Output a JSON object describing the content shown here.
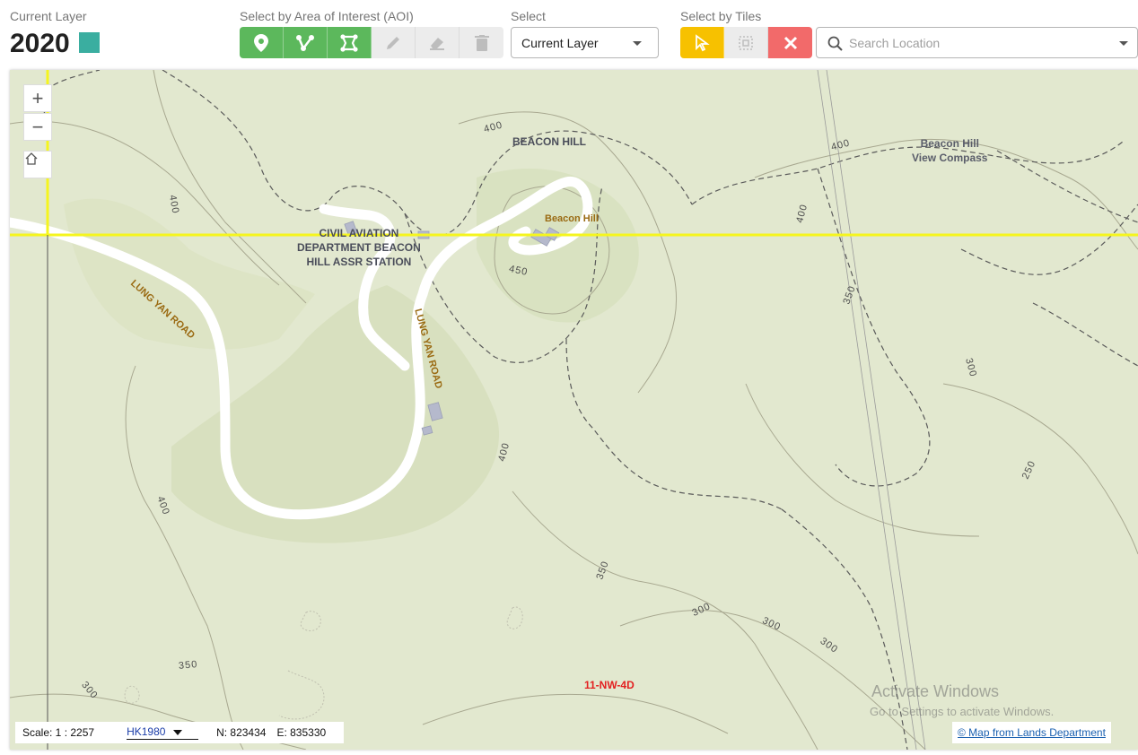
{
  "header": {
    "current_layer_label": "Current Layer",
    "year": "2020",
    "swatch_color": "#3aaea0",
    "aoi_label": "Select by Area of Interest (AOI)",
    "select_label": "Select",
    "select_value": "Current Layer",
    "tiles_label": "Select by Tiles",
    "search_placeholder": "Search Location"
  },
  "aoi_tools": [
    "point-icon",
    "polyline-icon",
    "polygon-icon",
    "pencil-icon",
    "eraser-icon",
    "trash-icon"
  ],
  "tile_tools": [
    "cursor-select-icon",
    "box-select-icon",
    "close-icon"
  ],
  "map": {
    "places": {
      "beacon_hill": "BEACON HILL",
      "beacon_hill_view_1": "Beacon Hill",
      "beacon_hill_view_2": "View Compass",
      "cad_1": "CIVIL AVIATION",
      "cad_2": "DEPARTMENT BEACON",
      "cad_3": "HILL ASSR STATION",
      "beacon_hill_peak": "Beacon Hill"
    },
    "roads": [
      "LUNG YAN ROAD",
      "LUNG YAN ROAD"
    ],
    "contours": [
      "400",
      "400",
      "400",
      "400",
      "450",
      "400",
      "350",
      "300",
      "250",
      "400",
      "350",
      "300",
      "300",
      "300",
      "350",
      "300"
    ],
    "tile_code": "11-NW-4D",
    "grid_line_color": "#f5f51e",
    "watermark_line1": "Activate Windows",
    "watermark_line2": "Go to Settings to activate Windows."
  },
  "statusbar": {
    "scale": "Scale: 1 : 2257",
    "crs": "HK1980",
    "northing": "N: 823434",
    "easting": "E: 835330"
  },
  "attribution": "© Map from Lands Department"
}
